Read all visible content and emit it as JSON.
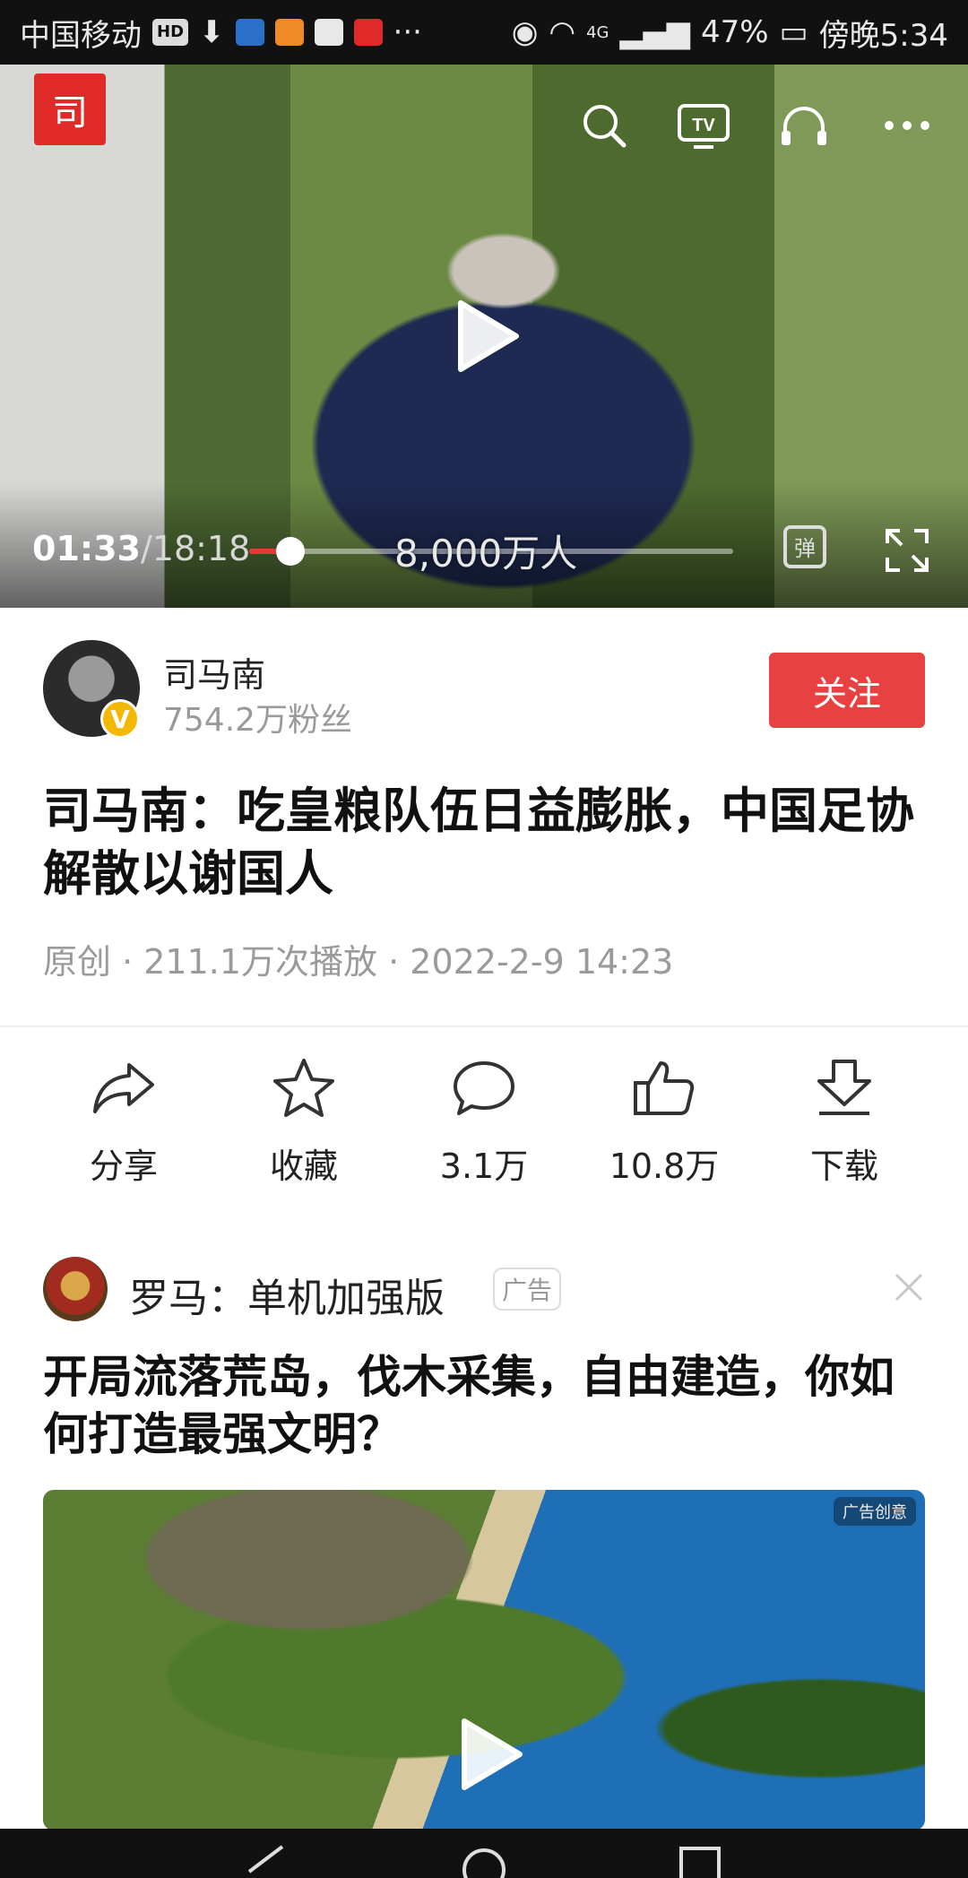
{
  "status_bar": {
    "carrier": "中国移动",
    "hd": "HD",
    "more": "···",
    "network": "4G",
    "battery": "47%",
    "time": "傍晚5:34"
  },
  "video": {
    "current_time": "01:33",
    "total_time": "/18:18",
    "progress": 0.085,
    "danmu": "8,000万人",
    "brand_glyph": "司"
  },
  "author": {
    "name": "司马南",
    "fans": "754.2万粉丝",
    "verified": "V",
    "follow_label": "关注"
  },
  "article": {
    "title": "司马南：吃皇粮队伍日益膨胀，中国足协解散以谢国人",
    "meta": "原创 · 211.1万次播放 · 2022-2-9 14:23"
  },
  "actions": [
    {
      "label": "分享",
      "icon": "share-icon"
    },
    {
      "label": "收藏",
      "icon": "star-icon"
    },
    {
      "label": "3.1万",
      "icon": "comment-icon"
    },
    {
      "label": "10.8万",
      "icon": "thumbs-up-icon"
    },
    {
      "label": "下载",
      "icon": "download-icon"
    }
  ],
  "ad": {
    "name": "罗马：单机加强版",
    "tag": "广告",
    "title": "开局流落荒岛，伐木采集，自由建造，你如何打造最强文明？",
    "image_badge": "广告创意"
  },
  "colors": {
    "accent_red": "#e84142",
    "progress_red": "#e53935",
    "muted_gray": "#9a9a9a"
  }
}
